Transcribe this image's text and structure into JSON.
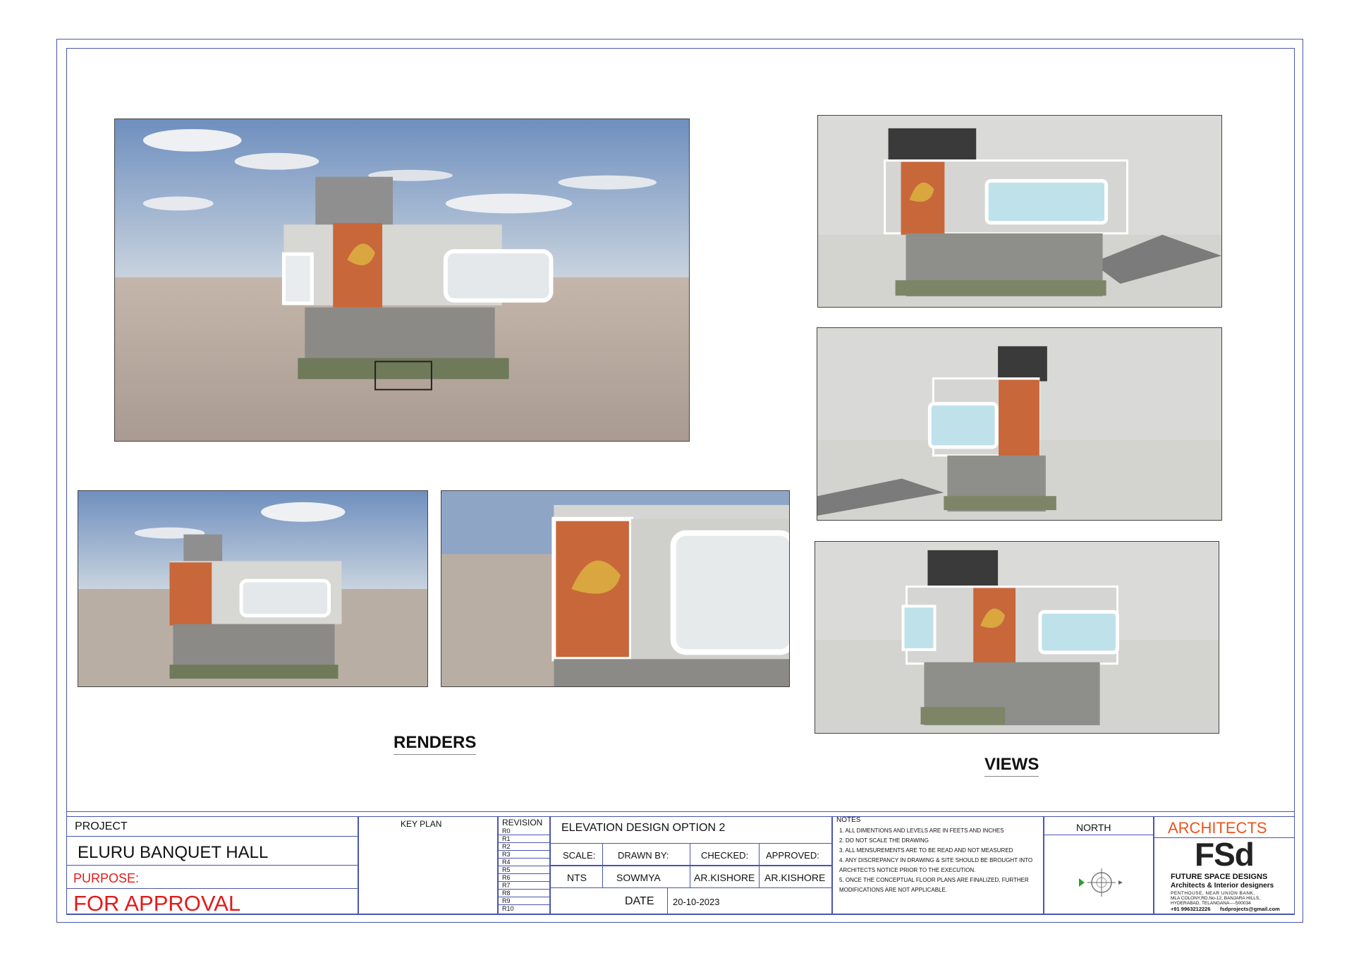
{
  "sections": {
    "renders_label": "RENDERS",
    "views_label": "VIEWS"
  },
  "title_block": {
    "project_label": "PROJECT",
    "project_name": "ELURU BANQUET HALL",
    "purpose_label": "PURPOSE:",
    "purpose_value": "FOR APPROVAL",
    "key_plan_label": "KEY PLAN",
    "revision_label": "REVISION",
    "revisions": [
      "R0",
      "R1",
      "R2",
      "R3",
      "R4",
      "R5",
      "R6",
      "R7",
      "R8",
      "R9",
      "R10"
    ],
    "drawing_title": "ELEVATION DESIGN OPTION 2",
    "scale_label": "SCALE:",
    "scale_value": "NTS",
    "drawn_by_label": "DRAWN BY:",
    "drawn_by_value": "SOWMYA",
    "checked_label": "CHECKED:",
    "checked_value": "AR.KISHORE",
    "approved_label": "APPROVED:",
    "approved_value": "AR.KISHORE",
    "date_label": "DATE",
    "date_value": "20-10-2023",
    "notes_label": "NOTES",
    "notes": [
      "1.   ALL DIMENTIONS AND LEVELS ARE IN FEETS AND INCHES",
      "2.   DO NOT SCALE THE DRAWING",
      "3.   ALL MENSUREMENTS ARE TO BE  READ AND NOT MEASURED",
      "4.   ANY DISCREPANCY IN DRAWING & SITE SHOULD BE BROUGHT INTO",
      "      ARCHITECTS NOTICE PRIOR TO THE EXECUTION.",
      "5.   ONCE THE CONCEPTUAL FLOOR PLANS ARE FINALIZED, FURTHER",
      "      MODIFICATIONS ARE NOT APPLICABLE."
    ],
    "north_label": "NORTH",
    "architects_label": "ARCHITECTS",
    "firm_logo": "FSd",
    "firm_name": "FUTURE SPACE DESIGNS",
    "firm_tagline": "Architects  &  Interior designers",
    "firm_address_1": "PENTHOUSE,  NEAR UNION BANK,",
    "firm_address_2": "MLA COLONY,RD.No-12,  BANJARA HILLS,",
    "firm_address_3": "HYDERABAD, TELANGANA----500034",
    "firm_phone": "+91 9963212226",
    "firm_email": "fsdprojects@gmail.com"
  },
  "colors": {
    "frame": "#4a55b0",
    "red": "#e21b1b",
    "orange": "#e8551e",
    "brick": "#c8673a",
    "sky": "#7f9fc8",
    "ground": "#b9aea4",
    "panel": "#d9d9d6",
    "glass": "#bfe1ea"
  }
}
